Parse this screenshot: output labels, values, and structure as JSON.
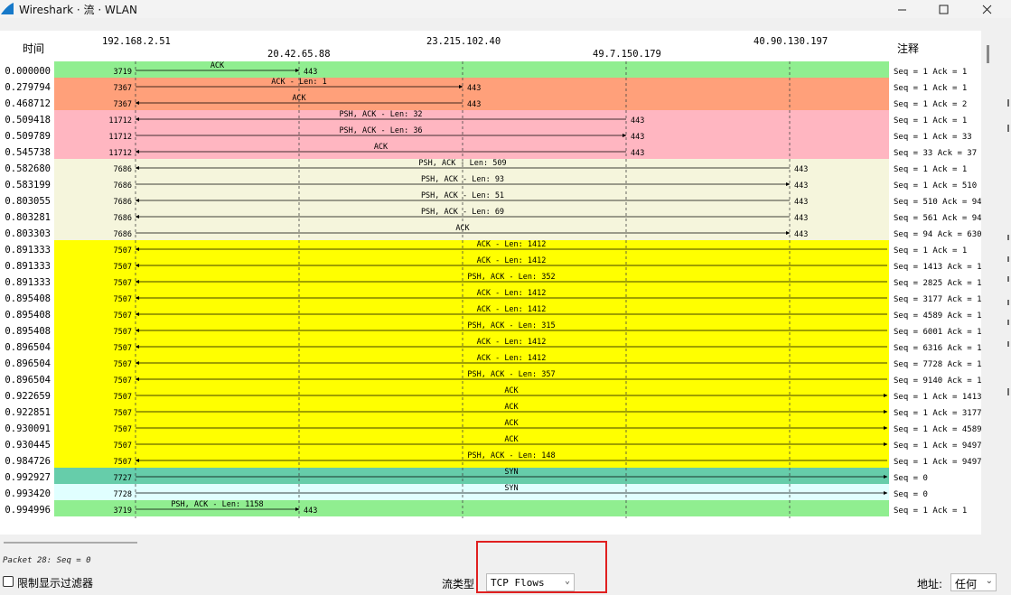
{
  "window": {
    "title": "Wireshark · 流 · WLAN"
  },
  "headers": {
    "time": "时间",
    "comment": "注释"
  },
  "hosts": [
    "192.168.2.51",
    "20.42.65.88",
    "23.215.102.40",
    "49.7.150.179",
    "40.90.130.197"
  ],
  "colors": {
    "green": "#90ee90",
    "salmon": "#ffa07a",
    "pink": "#ffb6c1",
    "beige": "#f5f5dc",
    "yellow": "#ffff00",
    "teal": "#66cdaa",
    "lightcyan": "#e0ffff"
  },
  "rows": [
    {
      "time": "0.000000",
      "port": "3719",
      "label": "ACK",
      "dst": "443",
      "from": 0,
      "to": 1,
      "color": "green",
      "comment": "Seq = 1 Ack = 1"
    },
    {
      "time": "0.279794",
      "port": "7367",
      "label": "ACK - Len: 1",
      "dst": "443",
      "from": 0,
      "to": 2,
      "color": "salmon",
      "comment": "Seq = 1 Ack = 1"
    },
    {
      "time": "0.468712",
      "port": "7367",
      "label": "ACK",
      "dst": "443",
      "from": 2,
      "to": 0,
      "color": "salmon",
      "comment": "Seq = 1 Ack = 2"
    },
    {
      "time": "0.509418",
      "port": "11712",
      "label": "PSH, ACK - Len: 32",
      "dst": "443",
      "from": 3,
      "to": 0,
      "color": "pink",
      "comment": "Seq = 1 Ack = 1"
    },
    {
      "time": "0.509789",
      "port": "11712",
      "label": "PSH, ACK - Len: 36",
      "dst": "443",
      "from": 0,
      "to": 3,
      "color": "pink",
      "comment": "Seq = 1 Ack = 33"
    },
    {
      "time": "0.545738",
      "port": "11712",
      "label": "ACK",
      "dst": "443",
      "from": 3,
      "to": 0,
      "color": "pink",
      "comment": "Seq = 33 Ack = 37"
    },
    {
      "time": "0.582680",
      "port": "7686",
      "label": "PSH, ACK - Len: 509",
      "dst": "443",
      "from": 4,
      "to": 0,
      "color": "beige",
      "comment": "Seq = 1 Ack = 1"
    },
    {
      "time": "0.583199",
      "port": "7686",
      "label": "PSH, ACK - Len: 93",
      "dst": "443",
      "from": 0,
      "to": 4,
      "color": "beige",
      "comment": "Seq = 1 Ack = 510"
    },
    {
      "time": "0.803055",
      "port": "7686",
      "label": "PSH, ACK - Len: 51",
      "dst": "443",
      "from": 4,
      "to": 0,
      "color": "beige",
      "comment": "Seq = 510 Ack = 94"
    },
    {
      "time": "0.803281",
      "port": "7686",
      "label": "PSH, ACK - Len: 69",
      "dst": "443",
      "from": 4,
      "to": 0,
      "color": "beige",
      "comment": "Seq = 561 Ack = 94"
    },
    {
      "time": "0.803303",
      "port": "7686",
      "label": "ACK",
      "dst": "443",
      "from": 0,
      "to": 4,
      "color": "beige",
      "comment": "Seq = 94 Ack = 630"
    },
    {
      "time": "0.891333",
      "port": "7507",
      "label": "ACK - Len: 1412",
      "dst": "",
      "from": 5,
      "to": 0,
      "color": "yellow",
      "comment": "Seq = 1 Ack = 1"
    },
    {
      "time": "0.891333",
      "port": "7507",
      "label": "ACK - Len: 1412",
      "dst": "",
      "from": 5,
      "to": 0,
      "color": "yellow",
      "comment": "Seq = 1413 Ack = 1"
    },
    {
      "time": "0.891333",
      "port": "7507",
      "label": "PSH, ACK - Len: 352",
      "dst": "",
      "from": 5,
      "to": 0,
      "color": "yellow",
      "comment": "Seq = 2825 Ack = 1"
    },
    {
      "time": "0.895408",
      "port": "7507",
      "label": "ACK - Len: 1412",
      "dst": "",
      "from": 5,
      "to": 0,
      "color": "yellow",
      "comment": "Seq = 3177 Ack = 1"
    },
    {
      "time": "0.895408",
      "port": "7507",
      "label": "ACK - Len: 1412",
      "dst": "",
      "from": 5,
      "to": 0,
      "color": "yellow",
      "comment": "Seq = 4589 Ack = 1"
    },
    {
      "time": "0.895408",
      "port": "7507",
      "label": "PSH, ACK - Len: 315",
      "dst": "",
      "from": 5,
      "to": 0,
      "color": "yellow",
      "comment": "Seq = 6001 Ack = 1"
    },
    {
      "time": "0.896504",
      "port": "7507",
      "label": "ACK - Len: 1412",
      "dst": "",
      "from": 5,
      "to": 0,
      "color": "yellow",
      "comment": "Seq = 6316 Ack = 1"
    },
    {
      "time": "0.896504",
      "port": "7507",
      "label": "ACK - Len: 1412",
      "dst": "",
      "from": 5,
      "to": 0,
      "color": "yellow",
      "comment": "Seq = 7728 Ack = 1"
    },
    {
      "time": "0.896504",
      "port": "7507",
      "label": "PSH, ACK - Len: 357",
      "dst": "",
      "from": 5,
      "to": 0,
      "color": "yellow",
      "comment": "Seq = 9140 Ack = 1"
    },
    {
      "time": "0.922659",
      "port": "7507",
      "label": "ACK",
      "dst": "",
      "from": 0,
      "to": 5,
      "color": "yellow",
      "comment": "Seq = 1 Ack = 1413"
    },
    {
      "time": "0.922851",
      "port": "7507",
      "label": "ACK",
      "dst": "",
      "from": 0,
      "to": 5,
      "color": "yellow",
      "comment": "Seq = 1 Ack = 3177"
    },
    {
      "time": "0.930091",
      "port": "7507",
      "label": "ACK",
      "dst": "",
      "from": 0,
      "to": 5,
      "color": "yellow",
      "comment": "Seq = 1 Ack = 4589"
    },
    {
      "time": "0.930445",
      "port": "7507",
      "label": "ACK",
      "dst": "",
      "from": 0,
      "to": 5,
      "color": "yellow",
      "comment": "Seq = 1 Ack = 9497"
    },
    {
      "time": "0.984726",
      "port": "7507",
      "label": "PSH, ACK - Len: 148",
      "dst": "",
      "from": 5,
      "to": 0,
      "color": "yellow",
      "comment": "Seq = 1 Ack = 9497"
    },
    {
      "time": "0.992927",
      "port": "7727",
      "label": "SYN",
      "dst": "",
      "from": 0,
      "to": 5,
      "color": "teal",
      "comment": "Seq = 0"
    },
    {
      "time": "0.993420",
      "port": "7728",
      "label": "SYN",
      "dst": "",
      "from": 0,
      "to": 5,
      "color": "lightcyan",
      "comment": "Seq = 0"
    },
    {
      "time": "0.994996",
      "port": "3719",
      "label": "PSH, ACK - Len: 1158",
      "dst": "443",
      "from": 0,
      "to": 1,
      "color": "green",
      "comment": "Seq = 1 Ack = 1"
    }
  ],
  "status": "Packet 28: Seq = 0",
  "controls": {
    "limit_filter_label": "限制显示过滤器",
    "flow_type_label": "流类型",
    "flow_type_value": "TCP Flows",
    "address_label": "地址:",
    "address_value": "任何"
  }
}
